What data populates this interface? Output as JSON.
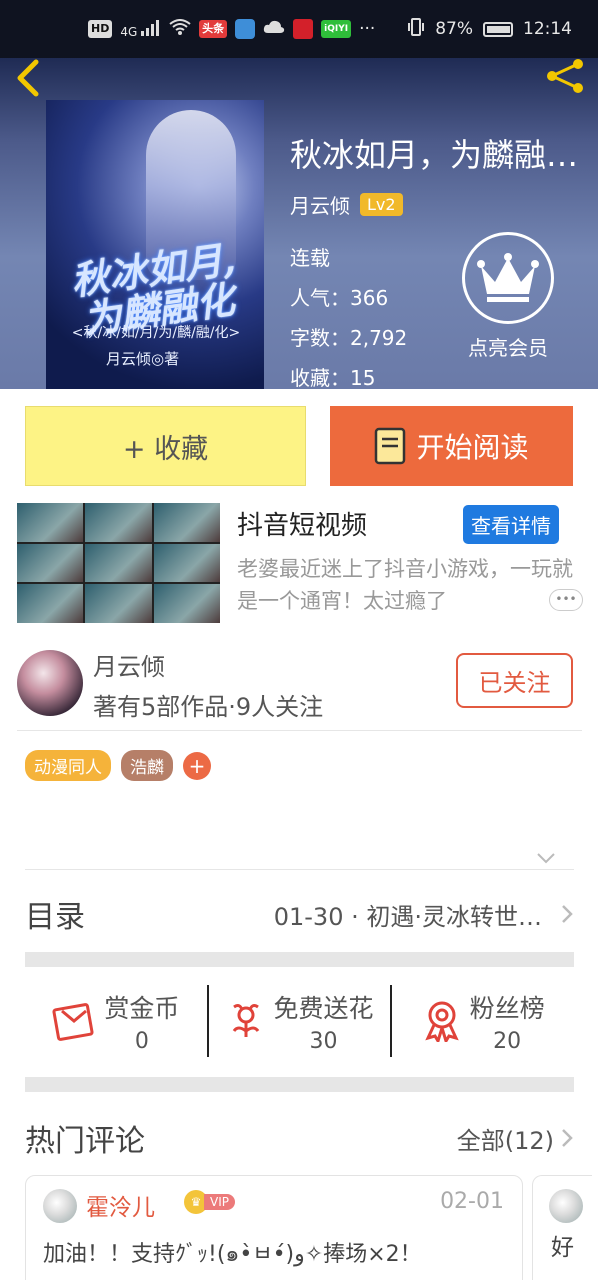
{
  "status_bar": {
    "icons": [
      "hd-icon",
      "4g-signal-icon",
      "wifi-icon",
      "toutiao-icon",
      "browser-icon",
      "cloud-icon",
      "game-icon",
      "iqiyi-icon",
      "more-dots-icon",
      "vibrate-icon",
      "battery-icon"
    ],
    "badge_hd": "HD",
    "badge_4g": "4G",
    "badge_toutiao": "头条",
    "badge_iqiyi": "iQIYI",
    "dots": "···",
    "battery": "87%",
    "time": "12:14"
  },
  "header": {
    "book_title": "秋冰如月，为麟融…",
    "author": "月云倾",
    "level": "Lv2",
    "status": "连载",
    "popularity": "人气：366",
    "word_count": "字数：2,792",
    "collections": "收藏：15",
    "vip_label": "点亮会员",
    "cover": {
      "title_line1": "秋冰如月,",
      "title_line2": "为麟融化",
      "subtitle": "<秋/冰/如/月/为/麟/融/化>",
      "author": "月云倾◎著"
    }
  },
  "actions_top": {
    "collect_label": "+ 收藏",
    "read_label": "开始阅读"
  },
  "ad": {
    "title": "抖音短视频",
    "button": "查看详情",
    "description": "老婆最近迷上了抖音小游戏，一玩就是一个通宵！太过瘾了"
  },
  "author_block": {
    "name": "月云倾",
    "info": "著有5部作品·9人关注",
    "follow_label": "已关注"
  },
  "tags": [
    "动漫同人",
    "浩麟"
  ],
  "tag_add": "+",
  "catalog": {
    "label": "目录",
    "latest": "01-30 · 初遇·灵冰转世…"
  },
  "support": [
    {
      "icon": "red-envelope-icon",
      "label": "赏金币",
      "value": "0"
    },
    {
      "icon": "flower-icon",
      "label": "免费送花",
      "value": "30"
    },
    {
      "icon": "medal-icon",
      "label": "粉丝榜",
      "value": "20"
    }
  ],
  "hot_comments": {
    "title": "热门评论",
    "all_label": "全部(12)",
    "first": {
      "user": "霍泠儿",
      "vip_badge": "VIP",
      "date": "02-01",
      "text": "加油！！支持ｸﾞｯ!(๑•̀ㅂ•́)و✧捧场×2！"
    },
    "second_preview": "好"
  },
  "colors": {
    "accent_orange": "#ed6a3d",
    "collect_yellow": "#fdf385",
    "link_blue": "#1f7ae0",
    "level_gold": "#f1b92a"
  }
}
